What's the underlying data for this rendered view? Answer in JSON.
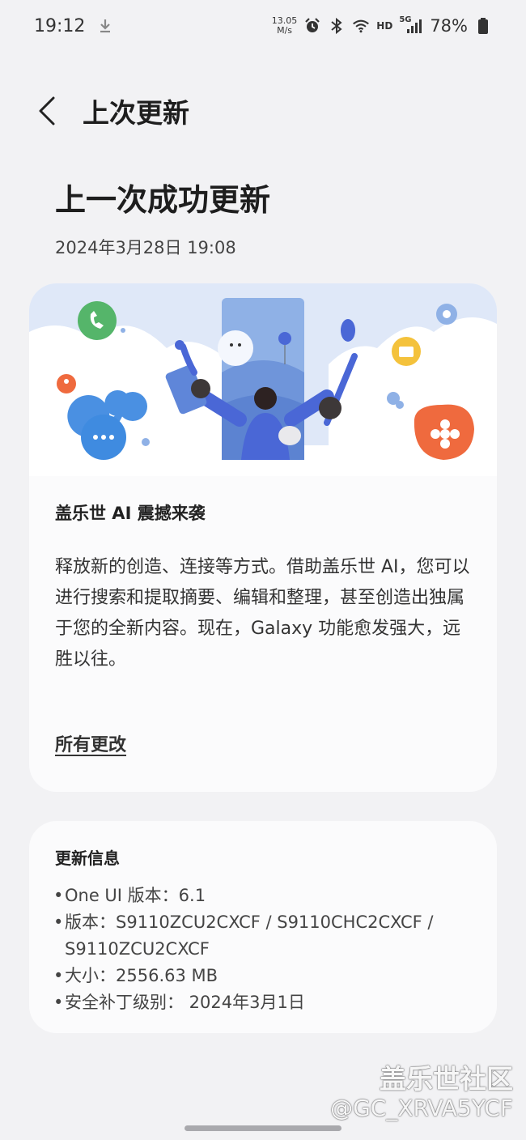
{
  "status_bar": {
    "time": "19:12",
    "net_speed_value": "13.05",
    "net_speed_unit": "M/s",
    "hd_label": "HD",
    "signal_label": "5G",
    "battery": "78%"
  },
  "header": {
    "title": "上次更新"
  },
  "page": {
    "title": "上一次成功更新",
    "date": "2024年3月28日 19:08"
  },
  "feature_card": {
    "title": "盖乐世 AI 震撼来袭",
    "description": "释放新的创造、连接等方式。借助盖乐世 AI，您可以进行搜索和提取摘要、编辑和整理，甚至创造出独属于您的全新内容。现在，Galaxy 功能愈发强大，远胜以往。",
    "link_label": "所有更改"
  },
  "info_card": {
    "title": "更新信息",
    "bullet": "•",
    "items": [
      "One UI 版本：6.1",
      "版本：S9110ZCU2CXCF / S9110CHC2CXCF / S9110ZCU2CXCF",
      "大小：2556.63 MB",
      "安全补丁级别： 2024年3月1日"
    ]
  },
  "watermark": {
    "line1": "盖乐世社区",
    "line2": "@GC_XRVA5YCF"
  },
  "colors": {
    "background": "#f2f2f4",
    "card": "#fbfbfc",
    "hero_sky": "#dfe8f8",
    "illustration_blue": "#4a67d6",
    "accent_orange": "#ef6a3e",
    "accent_green": "#55b56a",
    "accent_yellow": "#f4c23c"
  }
}
